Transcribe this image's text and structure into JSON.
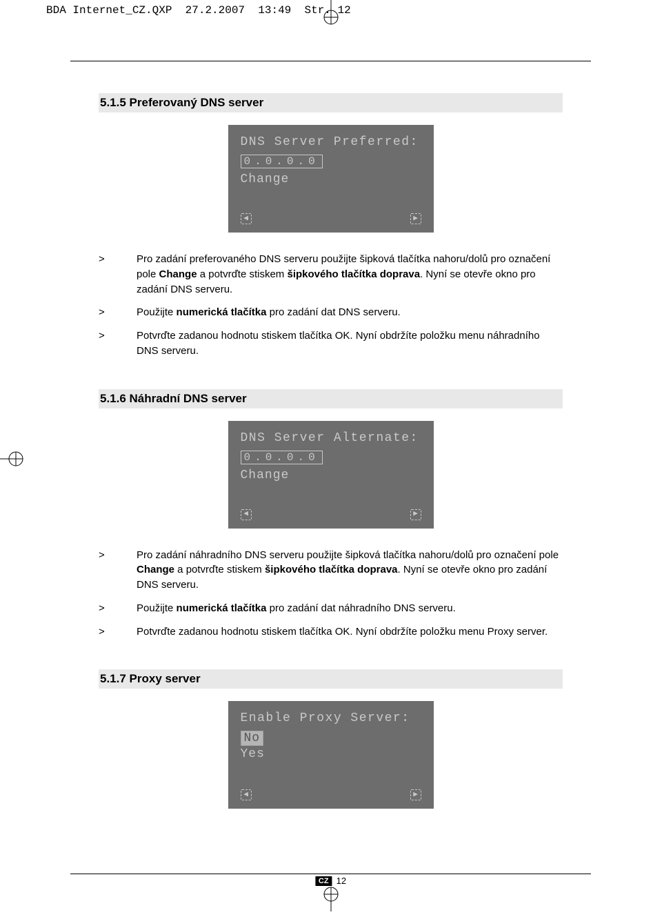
{
  "header": {
    "file": "BDA Internet_CZ.QXP",
    "date": "27.2.2007",
    "time": "13:49",
    "page_label": "Str. 12"
  },
  "sections": [
    {
      "heading": "5.1.5 Preferovaný DNS server",
      "screen": {
        "title": "DNS Server Preferred:",
        "value": "0.0.0.0",
        "options": [
          "Change"
        ],
        "selected_index": -1,
        "boxed_value": true
      },
      "instructions": [
        {
          "marker": ">",
          "html": "Pro zadání preferovaného DNS serveru použijte šipková tlačítka nahoru/dolů pro označení pole <b>Change</b> a potvrďte stiskem <b>šipkového tlačítka doprava</b>. Nyní se otevře okno pro zadání DNS serveru."
        },
        {
          "marker": ">",
          "html": "Použijte <b>numerická tlačítka</b> pro zadání dat DNS serveru."
        },
        {
          "marker": ">",
          "html": "Potvrďte zadanou hodnotu stiskem tlačítka OK. Nyní obdržíte položku menu náhradního DNS serveru."
        }
      ]
    },
    {
      "heading": "5.1.6 Náhradní DNS server",
      "screen": {
        "title": "DNS Server Alternate:",
        "value": "0.0.0.0",
        "options": [
          "Change"
        ],
        "selected_index": -1,
        "boxed_value": true
      },
      "instructions": [
        {
          "marker": ">",
          "html": "Pro zadání náhradního DNS serveru použijte šipková tlačítka nahoru/dolů pro označení pole <b>Change</b> a potvrďte stiskem <b>šipkového tlačítka doprava</b>. Nyní se otevře okno pro zadání DNS serveru."
        },
        {
          "marker": ">",
          "html": "Použijte <b>numerická tlačítka</b> pro zadání dat náhradního DNS serveru."
        },
        {
          "marker": ">",
          "html": "Potvrďte zadanou hodnotu stiskem tlačítka OK. Nyní obdržíte položku menu Proxy server."
        }
      ]
    },
    {
      "heading": "5.1.7 Proxy server",
      "screen": {
        "title": "Enable Proxy Server:",
        "value": "",
        "options": [
          "No",
          "Yes"
        ],
        "selected_index": 0,
        "boxed_value": false
      },
      "instructions": []
    }
  ],
  "footer": {
    "badge": "CZ",
    "page": "12"
  }
}
